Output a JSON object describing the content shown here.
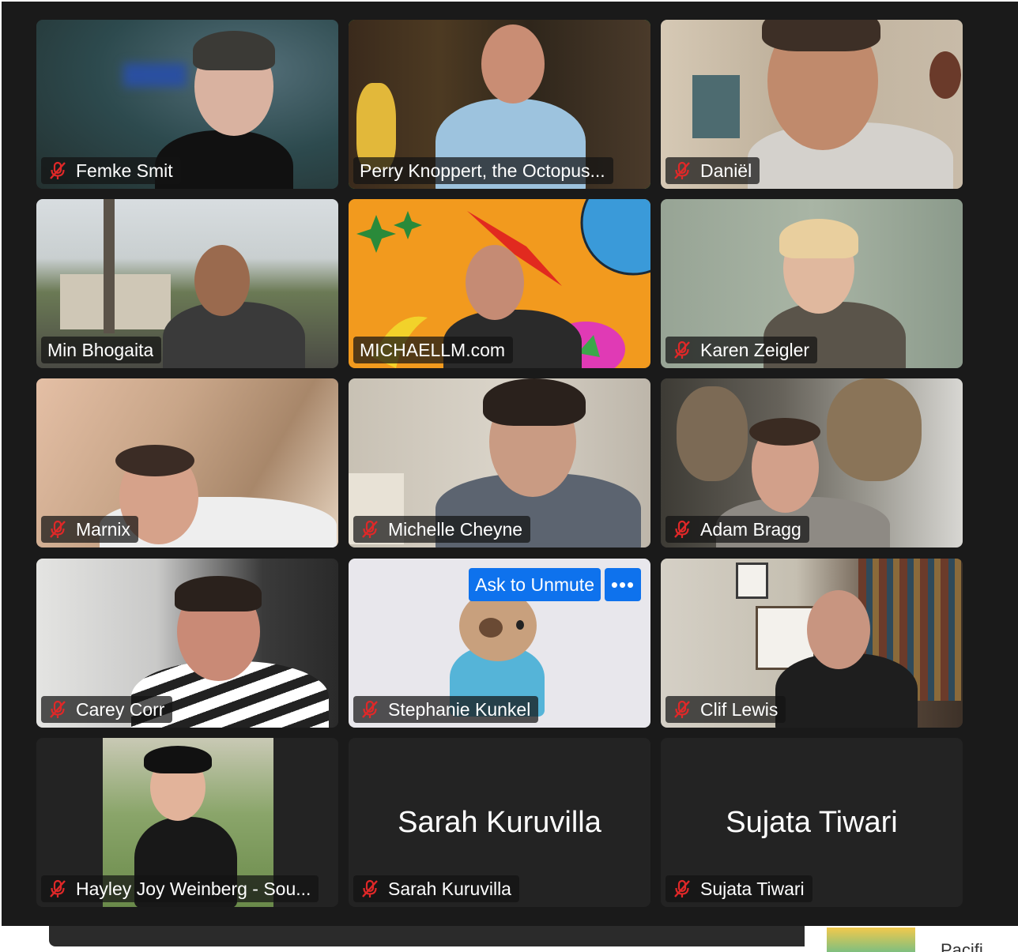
{
  "participants": [
    {
      "name": "Femke Smit",
      "muted": true,
      "active": false
    },
    {
      "name": "Perry Knoppert, the Octopus...",
      "muted": false,
      "active": true
    },
    {
      "name": "Daniël",
      "muted": true,
      "active": false
    },
    {
      "name": "Min Bhogaita",
      "muted": false,
      "active": false
    },
    {
      "name": "MICHAELLM.com",
      "muted": false,
      "active": false
    },
    {
      "name": "Karen Zeigler",
      "muted": true,
      "active": false
    },
    {
      "name": "Marnix",
      "muted": true,
      "active": false
    },
    {
      "name": "Michelle Cheyne",
      "muted": true,
      "active": false
    },
    {
      "name": "Adam Bragg",
      "muted": true,
      "active": false
    },
    {
      "name": "Carey Corr",
      "muted": true,
      "active": false
    },
    {
      "name": "Stephanie Kunkel",
      "muted": true,
      "active": false
    },
    {
      "name": "Clif Lewis",
      "muted": true,
      "active": false
    },
    {
      "name": "Hayley Joy Weinberg - Sou...",
      "muted": true,
      "active": false
    },
    {
      "name": "Sarah Kuruvilla",
      "muted": true,
      "active": false,
      "video_off_name": "Sarah Kuruvilla"
    },
    {
      "name": "Sujata Tiwari",
      "muted": true,
      "active": false,
      "video_off_name": "Sujata Tiwari"
    }
  ],
  "hover_controls": {
    "ask_to_unmute_label": "Ask to Unmute",
    "more_label": "•••"
  },
  "bottom": {
    "cut_text": "Pacifi"
  },
  "colors": {
    "active_speaker_border": "#3dd34a",
    "button_blue": "#0e72ed",
    "muted_icon_red": "#e02828",
    "window_bg": "#1a1a1a",
    "tile_bg": "#232323"
  }
}
